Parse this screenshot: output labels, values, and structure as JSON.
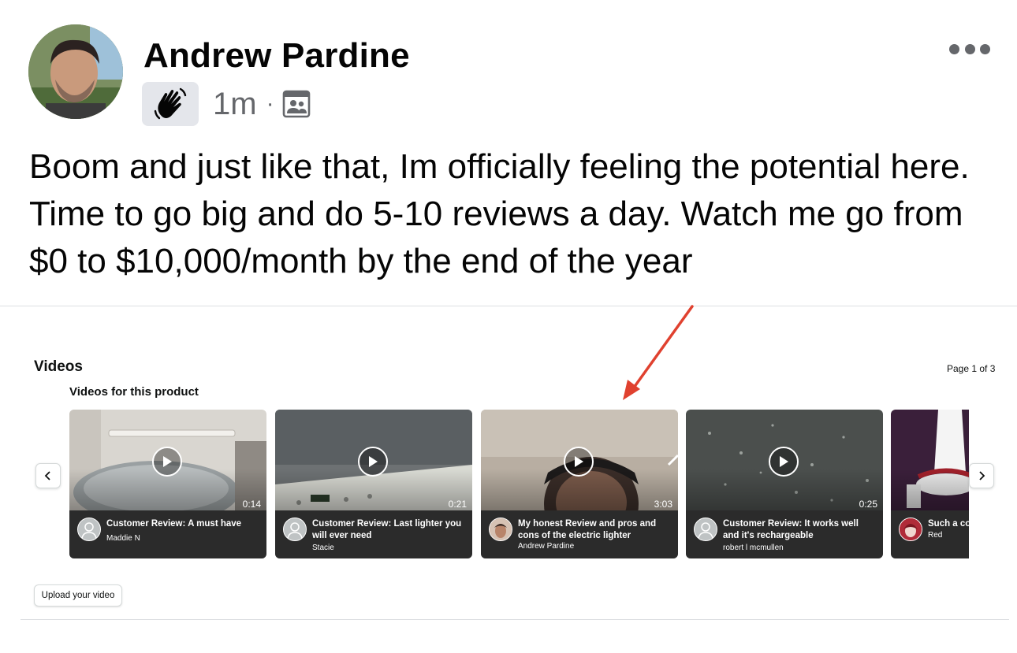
{
  "post": {
    "author": "Andrew Pardine",
    "time": "1m",
    "separator": "·",
    "text": "Boom and just like that, Im officially feeling the potential here. Time to go big and do 5-10 reviews a day. Watch me go from $0 to $10,000/month by the end of the year",
    "icons": [
      "profile-avatar",
      "waving-hand-icon",
      "audience-group-icon",
      "more-options-icon"
    ]
  },
  "videos_section": {
    "title": "Videos",
    "subtitle": "Videos for this product",
    "page_indicator": "Page 1 of 3",
    "upload_label": "Upload your video",
    "prev_icon": "chevron-left-icon",
    "next_icon": "chevron-right-icon",
    "items": [
      {
        "title": "Customer Review: A must have",
        "author": "Maddie N",
        "duration": "0:14"
      },
      {
        "title": "Customer Review: Last lighter you will ever need",
        "author": "Stacie",
        "duration": "0:21"
      },
      {
        "title": "My honest Review and pros and cons of the electric lighter",
        "author": "Andrew Pardine",
        "duration": "3:03"
      },
      {
        "title": "Customer Review: It works well and it's rechargeable",
        "author": "robert l mcmullen",
        "duration": "0:25"
      },
      {
        "title": "Such a co",
        "author": "Red",
        "duration": ""
      }
    ]
  },
  "colors": {
    "text": "#050505",
    "secondary_text": "#65676b",
    "annotation_arrow": "#e0412f",
    "card_info_bg": "#2b2b2b"
  }
}
